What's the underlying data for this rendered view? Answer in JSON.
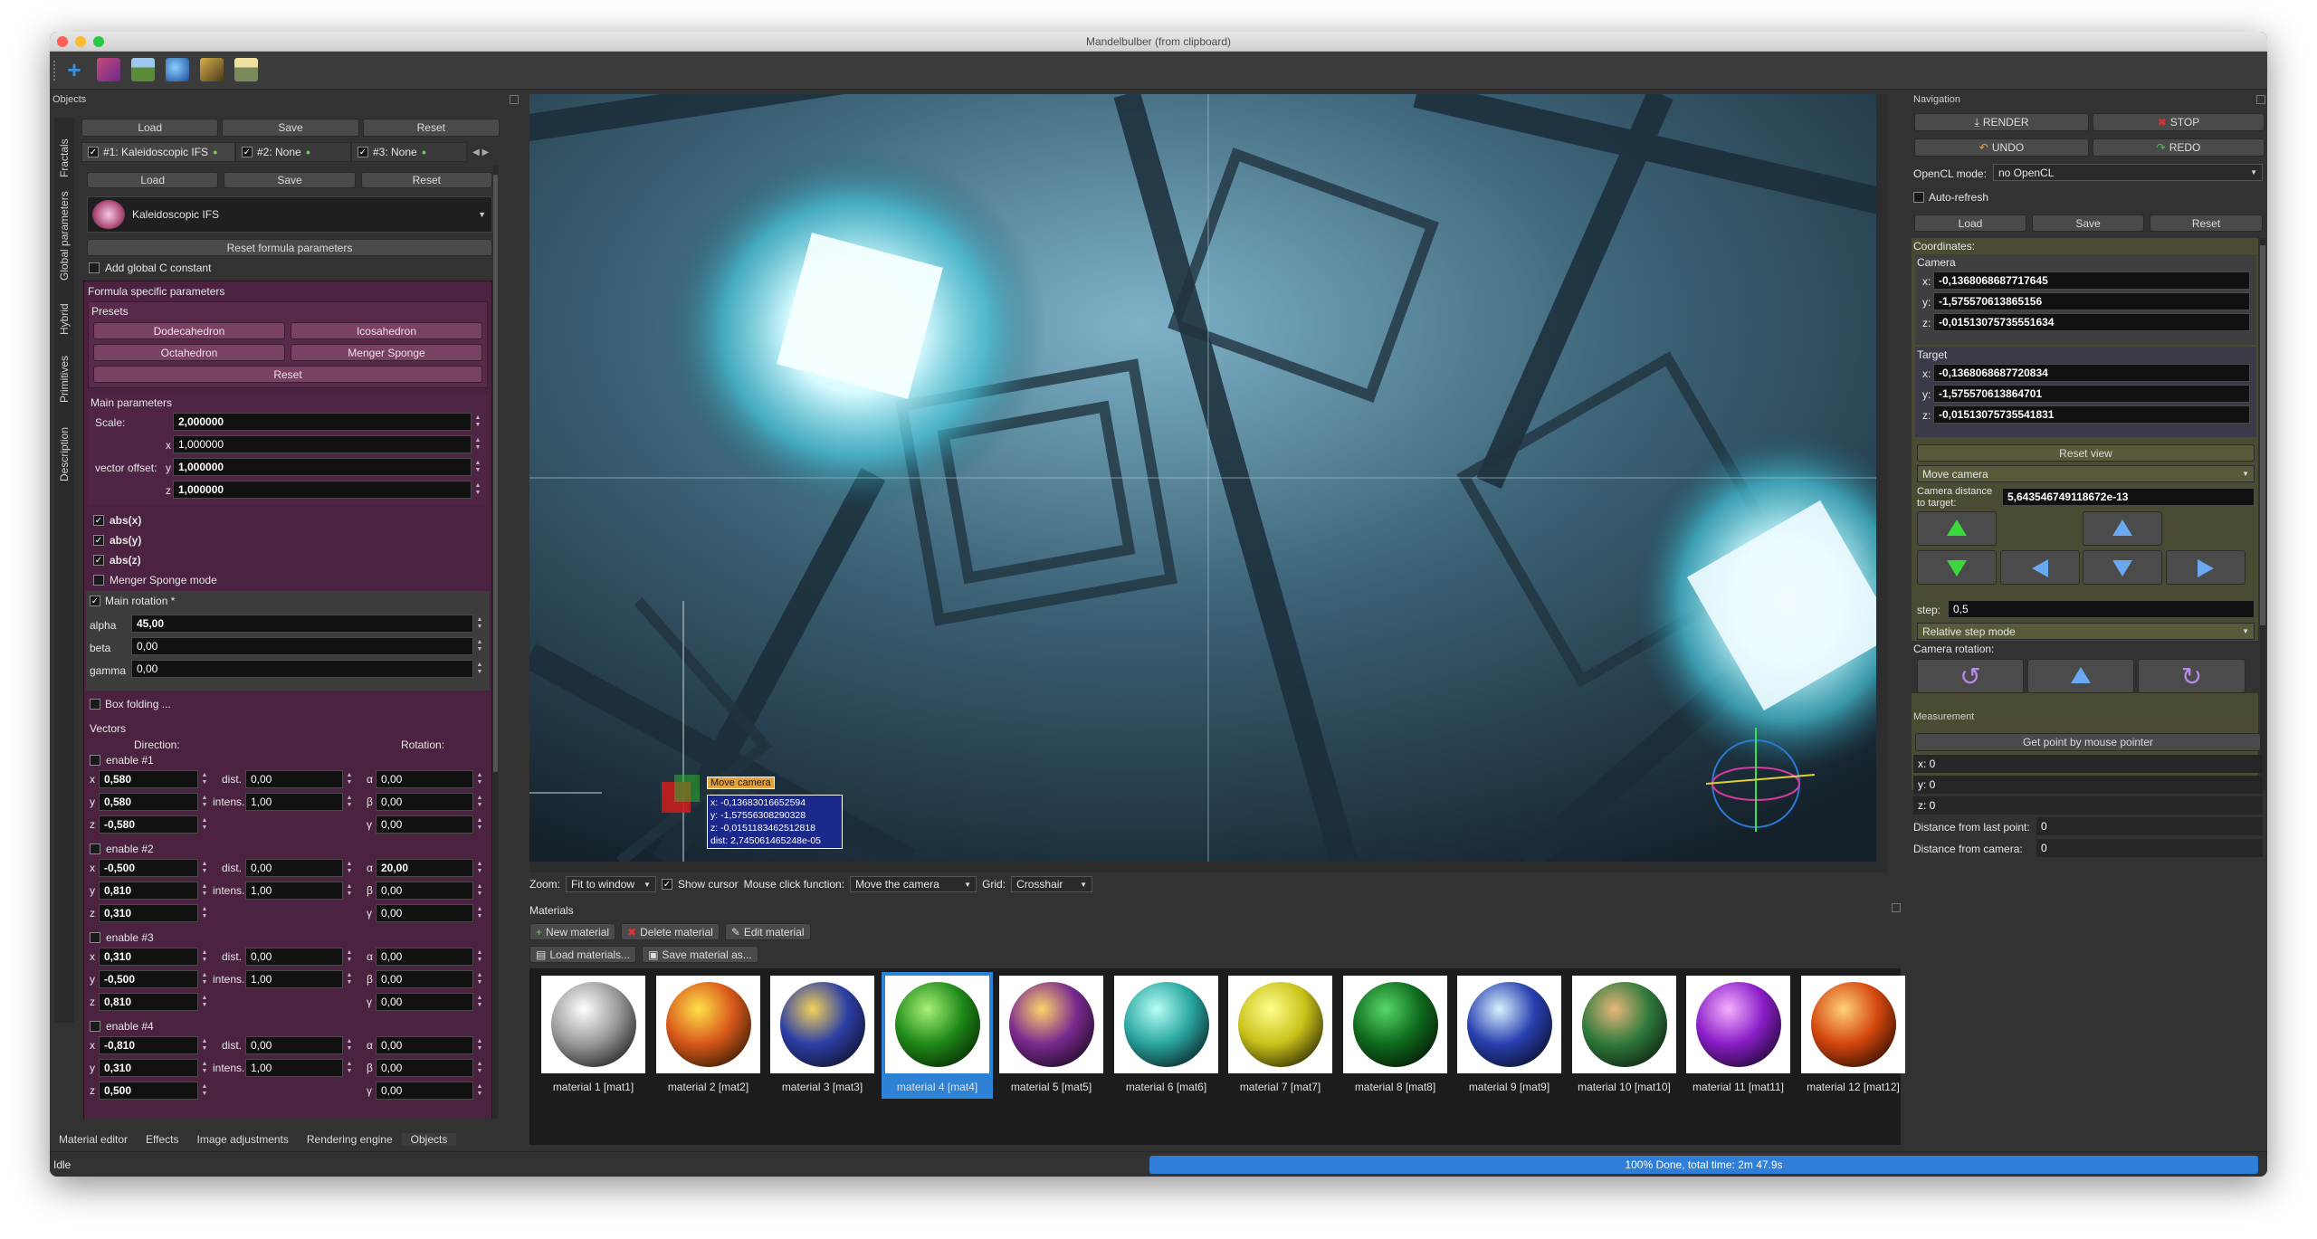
{
  "window": {
    "title": "Mandelbulber (from clipboard)"
  },
  "colors": {
    "accent_blue": "#2d82d6",
    "purple_panel": "#4b2340",
    "progress_blue": "#2f7fd8"
  },
  "toolbar": {
    "icons": [
      "add-icon",
      "palette-icon",
      "landscape-icon",
      "globe-icon",
      "fractal-icon",
      "image-icon"
    ]
  },
  "objects": {
    "header": "Objects",
    "top_buttons": [
      "Load",
      "Save",
      "Reset"
    ],
    "fractal_tabs": [
      "#1: Kaleidoscopic IFS",
      "#2: None",
      "#3: None"
    ],
    "sub_buttons": [
      "Load",
      "Save",
      "Reset"
    ],
    "formula_name": "Kaleidoscopic IFS",
    "reset_formula": "Reset formula parameters",
    "add_global_c": "Add global C constant",
    "formula_specific": "Formula specific parameters",
    "presets_label": "Presets",
    "presets": [
      "Dodecahedron",
      "Icosahedron",
      "Octahedron",
      "Menger Sponge"
    ],
    "presets_reset": "Reset",
    "main_params_label": "Main parameters",
    "scale_label": "Scale:",
    "scale_value": "2,000000",
    "vector_offset_label": "vector offset:",
    "offset_x_label": "x",
    "offset_x": "1,000000",
    "offset_y_label": "y",
    "offset_y": "1,000000",
    "offset_z_label": "z",
    "offset_z": "1,000000",
    "abs_x": "abs(x)",
    "abs_y": "abs(y)",
    "abs_z": "abs(z)",
    "menger_mode": "Menger Sponge mode",
    "main_rotation": "Main rotation *",
    "alpha_label": "alpha",
    "alpha": "45,00",
    "beta_label": "beta",
    "beta": "0,00",
    "gamma_label": "gamma",
    "gamma": "0,00",
    "box_folding": "Box folding ...",
    "vectors_label": "Vectors",
    "direction_label": "Direction:",
    "rotation_label": "Rotation:",
    "dist_label": "dist.",
    "intens_label": "intens.",
    "vectors": [
      {
        "enable": "enable #1",
        "x": "0,580",
        "y": "0,580",
        "z": "-0,580",
        "dist": "0,00",
        "intens": "1,00",
        "a": "0,00",
        "b": "0,00",
        "g": "0,00"
      },
      {
        "enable": "enable #2",
        "x": "-0,500",
        "y": "0,810",
        "z": "0,310",
        "dist": "0,00",
        "intens": "1,00",
        "a": "20,00",
        "b": "0,00",
        "g": "0,00"
      },
      {
        "enable": "enable #3",
        "x": "0,310",
        "y": "-0,500",
        "z": "0,810",
        "dist": "0,00",
        "intens": "1,00",
        "a": "0,00",
        "b": "0,00",
        "g": "0,00"
      },
      {
        "enable": "enable #4",
        "x": "-0,810",
        "y": "0,310",
        "z": "0,500",
        "dist": "0,00",
        "intens": "1,00",
        "a": "0,00",
        "b": "0,00",
        "g": "0,00"
      }
    ],
    "side_tabs": [
      "Fractals",
      "Global parameters",
      "Hybrid",
      "Primitives",
      "Description"
    ]
  },
  "bottom_tabs": [
    "Material editor",
    "Effects",
    "Image adjustments",
    "Rendering engine",
    "Objects"
  ],
  "viewport": {
    "move_camera_label": "Move camera",
    "readout": [
      "x: -0,13683016652594",
      "y: -1,57556308290328",
      "z: -0,0151183462512818",
      "dist: 2,745061465248e-05"
    ]
  },
  "view_controls": {
    "zoom_label": "Zoom:",
    "zoom_value": "Fit to window",
    "show_cursor": "Show cursor",
    "mouse_click_label": "Mouse click function:",
    "mouse_click_value": "Move the camera",
    "grid_label": "Grid:",
    "grid_value": "Crosshair"
  },
  "materials": {
    "header": "Materials",
    "new": "New material",
    "delete": "Delete material",
    "edit": "Edit material",
    "load": "Load materials...",
    "save": "Save material as...",
    "items": [
      {
        "label": "material 1 [mat1]",
        "c1": "#ffffff",
        "c2": "#9a9a9a",
        "c3": "#101010"
      },
      {
        "label": "material 2 [mat2]",
        "c1": "#ffe24a",
        "c2": "#d8571a",
        "c3": "#1c1400"
      },
      {
        "label": "material 3 [mat3]",
        "c1": "#f2d35a",
        "c2": "#2c3fa5",
        "c3": "#0c0c1e"
      },
      {
        "label": "material 4 [mat4]",
        "c1": "#a9f07a",
        "c2": "#1f8a18",
        "c3": "#031a02"
      },
      {
        "label": "material 5 [mat5]",
        "c1": "#ffd36a",
        "c2": "#7a2a8f",
        "c3": "#100614"
      },
      {
        "label": "material 6 [mat6]",
        "c1": "#b6fff6",
        "c2": "#2aa6a0",
        "c3": "#050f12"
      },
      {
        "label": "material 7 [mat7]",
        "c1": "#fffe8a",
        "c2": "#c9c21a",
        "c3": "#141400"
      },
      {
        "label": "material 8 [mat8]",
        "c1": "#56d86a",
        "c2": "#0f6a1c",
        "c3": "#020a03"
      },
      {
        "label": "material 9 [mat9]",
        "c1": "#d8f2ff",
        "c2": "#2840b0",
        "c3": "#06081a"
      },
      {
        "label": "material 10 [mat10]",
        "c1": "#e8b77a",
        "c2": "#2f7a3c",
        "c3": "#0a130a"
      },
      {
        "label": "material 11 [mat11]",
        "c1": "#f4b0ff",
        "c2": "#8a1ec8",
        "c3": "#0e0418"
      },
      {
        "label": "material 12 [mat12]",
        "c1": "#ffd07a",
        "c2": "#d4460e",
        "c3": "#180600"
      }
    ],
    "selected_index": 3
  },
  "navigation": {
    "header": "Navigation",
    "render": "RENDER",
    "stop": "STOP",
    "undo": "UNDO",
    "redo": "REDO",
    "opencl_label": "OpenCL mode:",
    "opencl_value": "no OpenCL",
    "auto_refresh": "Auto-refresh",
    "load": "Load",
    "save": "Save",
    "reset": "Reset",
    "coordinates": "Coordinates:",
    "camera_label": "Camera",
    "camera_x": "-0,1368068687717645",
    "camera_y": "-1,575570613865156",
    "camera_z": "-0,01513075735551634",
    "target_label": "Target",
    "target_x": "-0,1368068687720834",
    "target_y": "-1,575570613864701",
    "target_z": "-0,01513075735541831",
    "reset_view": "Reset view",
    "move_mode": "Move camera",
    "cam_dist_label": "Camera distance to target:",
    "cam_dist_value": "5,643546749118672e-13",
    "step_label": "step:",
    "step_value": "0,5",
    "step_mode": "Relative step mode",
    "camera_rotation": "Camera rotation:"
  },
  "measurement": {
    "header": "Measurement",
    "get_point": "Get point by mouse pointer",
    "x": "x: 0",
    "y": "y: 0",
    "z": "z: 0",
    "dist_last_label": "Distance from last point:",
    "dist_last": "0",
    "dist_cam_label": "Distance from camera:",
    "dist_cam": "0"
  },
  "status": {
    "left": "Idle",
    "progress_text": "100% Done, total time: 2m 47.9s",
    "progress_fraction": 1.0
  }
}
